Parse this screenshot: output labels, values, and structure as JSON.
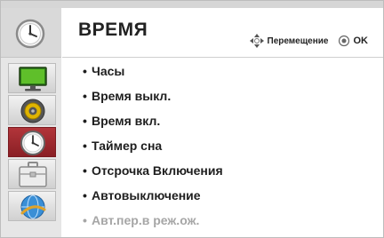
{
  "header": {
    "title": "ВРЕМЯ",
    "nav_label": "Перемещение",
    "ok_label": "OK",
    "nav_icon": "four-way-arrows-icon",
    "ok_icon": "ok-button-icon"
  },
  "sidebar": {
    "header_icon": "clock-icon",
    "tabs": [
      {
        "icon": "picture-monitor-icon",
        "selected": false
      },
      {
        "icon": "audio-speaker-icon",
        "selected": false
      },
      {
        "icon": "clock-icon",
        "selected": true
      },
      {
        "icon": "toolbox-icon",
        "selected": false
      },
      {
        "icon": "globe-icon",
        "selected": false
      }
    ]
  },
  "menu": {
    "bullet": "•",
    "items": [
      {
        "label": "Часы",
        "enabled": true
      },
      {
        "label": "Время выкл.",
        "enabled": true
      },
      {
        "label": "Время вкл.",
        "enabled": true
      },
      {
        "label": "Таймер сна",
        "enabled": true
      },
      {
        "label": "Отсрочка Включения",
        "enabled": true
      },
      {
        "label": "Автовыключение",
        "enabled": true
      },
      {
        "label": "Авт.пер.в реж.ож.",
        "enabled": false
      }
    ]
  },
  "colors": {
    "selected_tab": "#9b2a2f",
    "sidebar_bg": "#e6e6e6",
    "disabled_text": "#a6a6a6"
  }
}
